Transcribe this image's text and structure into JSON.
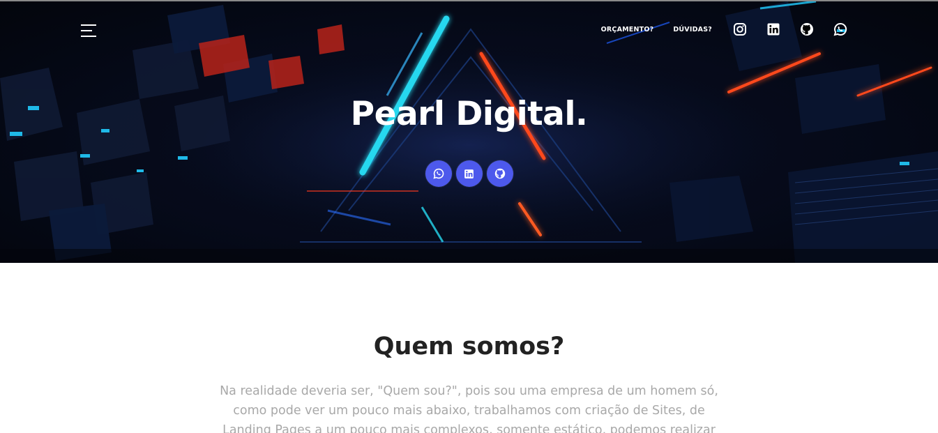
{
  "header": {
    "nav_links": [
      "ORÇAMENTO?",
      "DÚVIDAS?"
    ],
    "icons": [
      "instagram-icon",
      "linkedin-icon",
      "github-icon",
      "whatsapp-icon"
    ]
  },
  "hero": {
    "title": "Pearl Digital.",
    "social_buttons": [
      "whatsapp-icon",
      "linkedin-icon",
      "github-icon"
    ]
  },
  "about": {
    "title": "Quem somos?",
    "text": "Na realidade deveria ser, \"Quem sou?\", pois sou uma empresa de um homem só, como pode ver um pouco mais abaixo, trabalhamos com criação de Sites, de Landing Pages a um pouco mais complexos, somente estático, podemos realizar"
  },
  "colors": {
    "accent": "#4d59ec",
    "neon_cyan": "#27d8ef",
    "neon_red": "#ff3a1e",
    "hero_dark": "#060b1c",
    "title_dark": "#222222",
    "text_gray": "#a8a8a8"
  }
}
